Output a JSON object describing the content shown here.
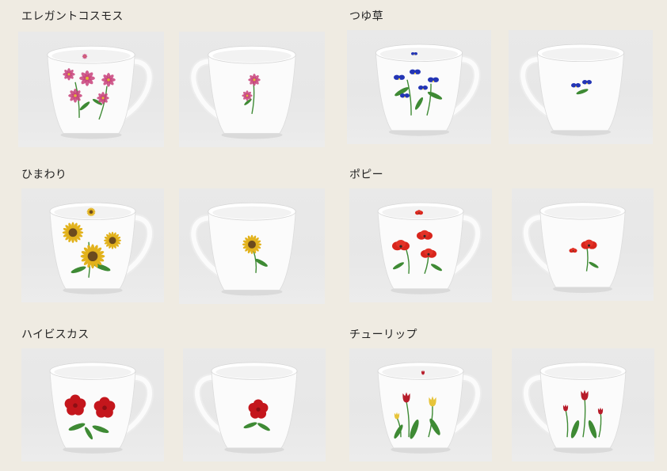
{
  "colors": {
    "background": "#efebe2",
    "photo_background": "#e8e8e8",
    "mug_white": "#fbfbfb",
    "cosmos_pink": "#c8417a",
    "bluebell_blue": "#2335b5",
    "sunflower_yellow": "#e2b21c",
    "poppy_red": "#d8251c",
    "hibiscus_red": "#c4161c",
    "tulip_red": "#b71c2a",
    "tulip_yellow": "#e7c43a",
    "leaf_green": "#3e8a34"
  },
  "sections": [
    {
      "title": "エレガントコスモス",
      "flower": "cosmos"
    },
    {
      "title": "つゆ草",
      "flower": "dayflower"
    },
    {
      "title": "ひまわり",
      "flower": "sunflower"
    },
    {
      "title": "ポピー",
      "flower": "poppy"
    },
    {
      "title": "ハイビスカス",
      "flower": "hibiscus"
    },
    {
      "title": "チューリップ",
      "flower": "tulip"
    }
  ]
}
